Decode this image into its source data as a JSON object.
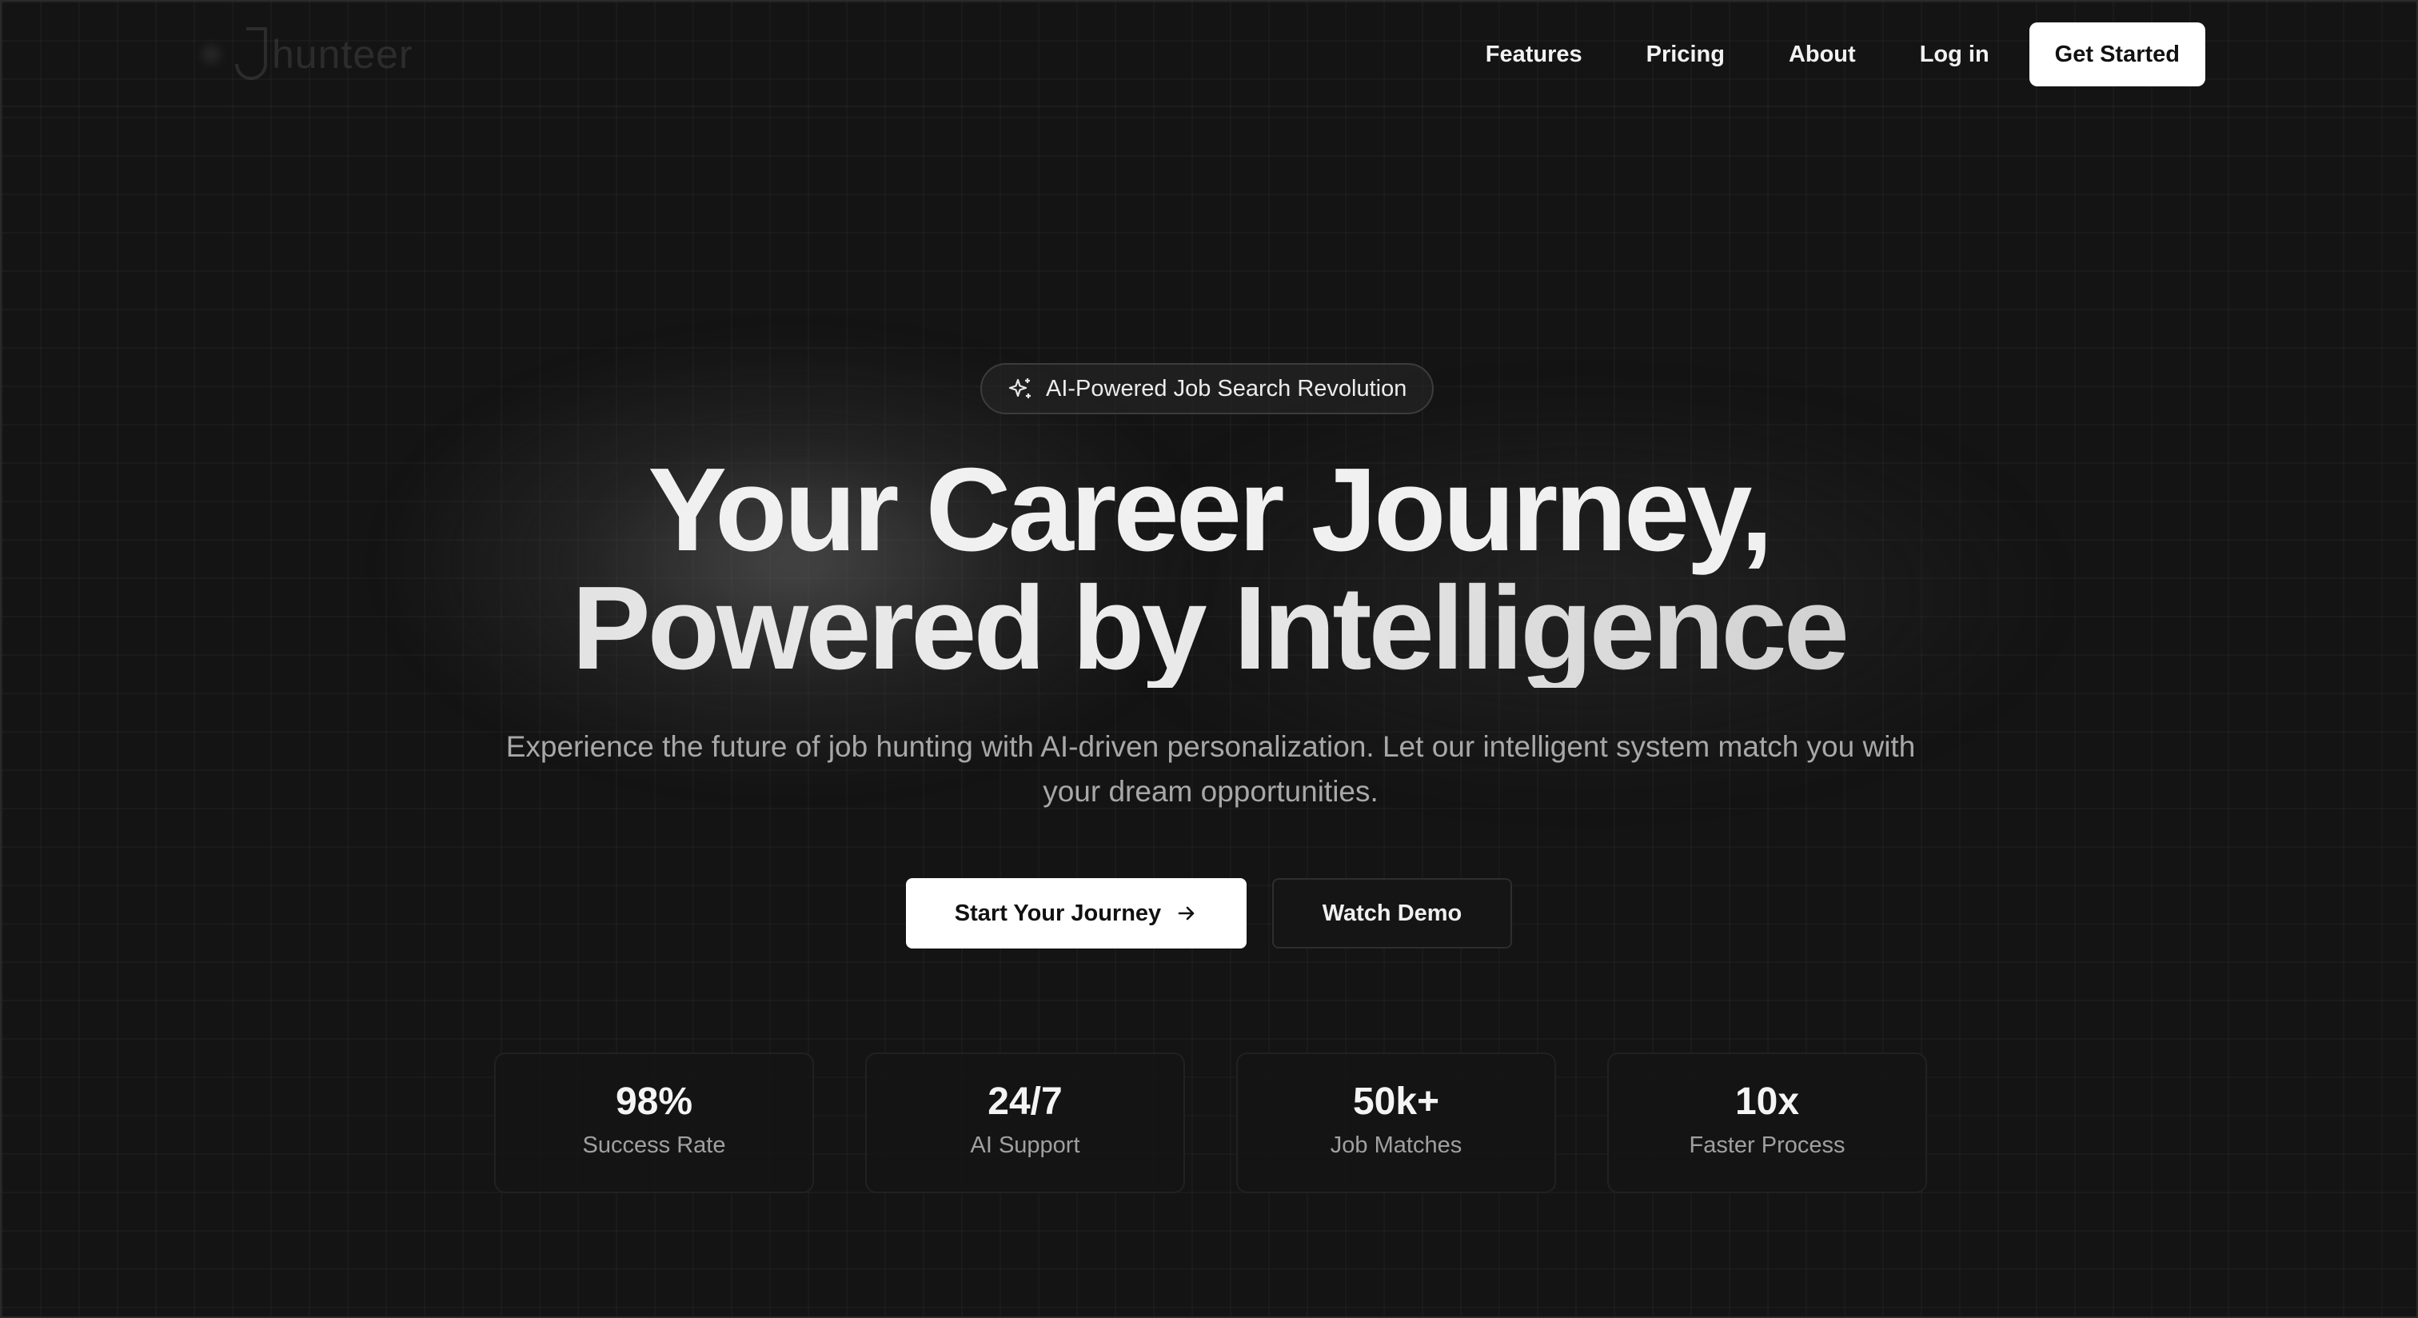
{
  "brand": {
    "name": "hunteer"
  },
  "nav": {
    "links": [
      "Features",
      "Pricing",
      "About",
      "Log in"
    ],
    "cta": "Get Started"
  },
  "hero": {
    "badge": "AI-Powered Job Search Revolution",
    "headline_line1": "Your Career Journey,",
    "headline_line2": "Powered by Intelligence",
    "subtitle": "Experience the future of job hunting with AI-driven personalization. Let our intelligent system match you with your dream opportunities.",
    "primary_button": "Start Your Journey",
    "secondary_button": "Watch Demo"
  },
  "stats": [
    {
      "value": "98%",
      "label": "Success Rate"
    },
    {
      "value": "24/7",
      "label": "AI Support"
    },
    {
      "value": "50k+",
      "label": "Job Matches"
    },
    {
      "value": "10x",
      "label": "Faster Process"
    }
  ],
  "icons": {
    "badge_icon": "sparkles-icon",
    "primary_button_icon": "arrow-right-icon"
  },
  "colors": {
    "background": "#141414",
    "primary_button_bg": "#ffffff",
    "text": "#f0f0f0",
    "muted_text": "#a8a8a8"
  }
}
